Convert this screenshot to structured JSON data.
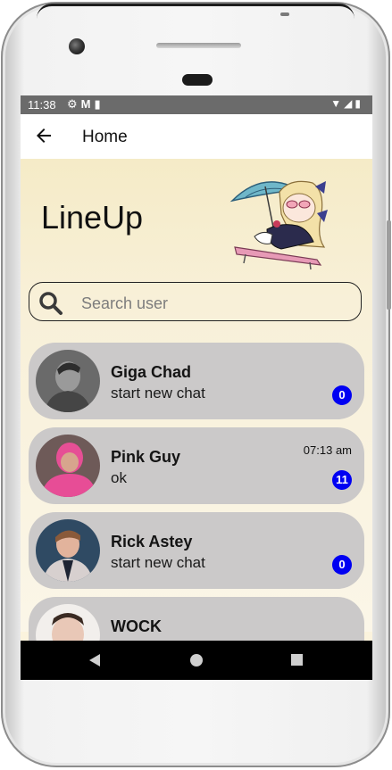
{
  "status_bar": {
    "time": "11:38",
    "left_icons": [
      "gear-icon",
      "gmail-icon",
      "sd-card-icon"
    ],
    "right_icons": [
      "wifi-icon",
      "signal-icon",
      "battery-icon"
    ]
  },
  "app_bar": {
    "title": "Home",
    "back_icon": "arrow-left-icon"
  },
  "header": {
    "brand": "LineUp",
    "mascot": "chibi-character-under-umbrella"
  },
  "search": {
    "placeholder": "Search user"
  },
  "chats": [
    {
      "name": "Giga Chad",
      "message": "start new chat",
      "time": "",
      "unread": "0",
      "avatar": "grayscale-portrait"
    },
    {
      "name": "Pink Guy",
      "message": "ok",
      "time": "07:13 am",
      "unread": "11",
      "avatar": "pink-suit-portrait"
    },
    {
      "name": "Rick Astey",
      "message": "start new chat",
      "time": "",
      "unread": "0",
      "avatar": "rick-portrait"
    },
    {
      "name": "WOCK",
      "message": "",
      "time": "",
      "unread": "",
      "avatar": "face-portrait"
    }
  ],
  "nav_bar": {
    "icons": [
      "nav-back-icon",
      "nav-home-icon",
      "nav-recents-icon"
    ]
  },
  "colors": {
    "badge": "#0000f2",
    "chat_card": "#cbc9c9",
    "background": "#f8f0d8",
    "status_bar": "#6b6b6b"
  }
}
